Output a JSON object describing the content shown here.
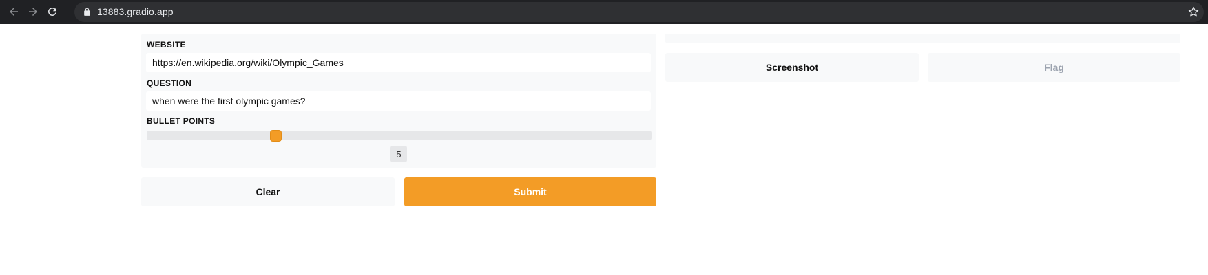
{
  "browser": {
    "url": "13883.gradio.app",
    "back_icon": "arrow-left-icon",
    "forward_icon": "arrow-right-icon",
    "reload_icon": "reload-icon",
    "lock_icon": "lock-icon",
    "bookmark_icon": "star-icon"
  },
  "inputs": {
    "website": {
      "label": "WEBSITE",
      "value": "https://en.wikipedia.org/wiki/Olympic_Games"
    },
    "question": {
      "label": "QUESTION",
      "value": "when were the first olympic games?"
    },
    "bullet_points": {
      "label": "BULLET POINTS",
      "value": "5",
      "fraction": 0.25
    }
  },
  "actions": {
    "clear_label": "Clear",
    "submit_label": "Submit"
  },
  "output": {
    "screenshot_label": "Screenshot",
    "flag_label": "Flag"
  },
  "colors": {
    "accent": "#f39c26",
    "panel_bg": "#f8f9fa",
    "chrome_bg": "#202124"
  }
}
